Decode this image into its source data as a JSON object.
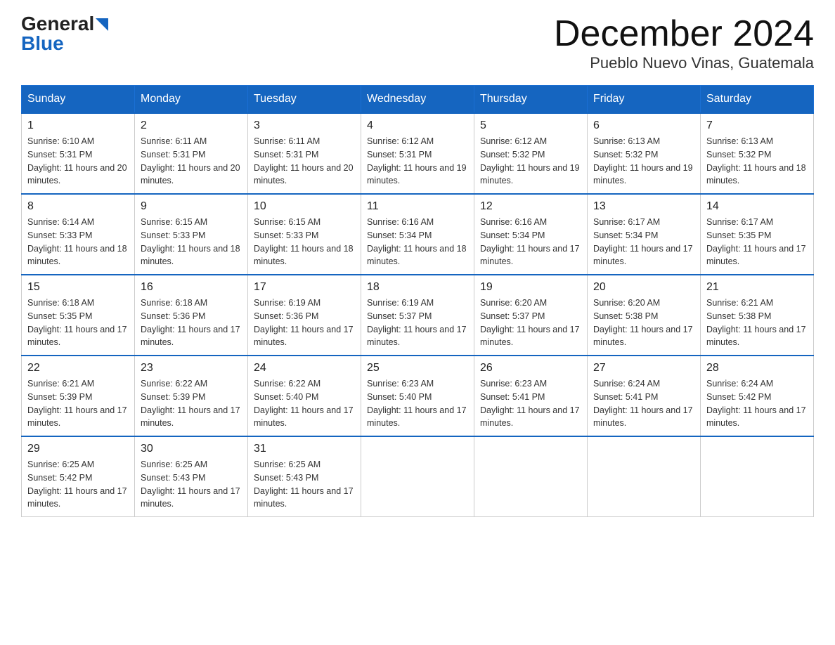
{
  "logo": {
    "general": "General",
    "blue": "Blue"
  },
  "title": "December 2024",
  "subtitle": "Pueblo Nuevo Vinas, Guatemala",
  "calendar": {
    "headers": [
      "Sunday",
      "Monday",
      "Tuesday",
      "Wednesday",
      "Thursday",
      "Friday",
      "Saturday"
    ],
    "weeks": [
      [
        {
          "day": "1",
          "sunrise": "6:10 AM",
          "sunset": "5:31 PM",
          "daylight": "11 hours and 20 minutes."
        },
        {
          "day": "2",
          "sunrise": "6:11 AM",
          "sunset": "5:31 PM",
          "daylight": "11 hours and 20 minutes."
        },
        {
          "day": "3",
          "sunrise": "6:11 AM",
          "sunset": "5:31 PM",
          "daylight": "11 hours and 20 minutes."
        },
        {
          "day": "4",
          "sunrise": "6:12 AM",
          "sunset": "5:31 PM",
          "daylight": "11 hours and 19 minutes."
        },
        {
          "day": "5",
          "sunrise": "6:12 AM",
          "sunset": "5:32 PM",
          "daylight": "11 hours and 19 minutes."
        },
        {
          "day": "6",
          "sunrise": "6:13 AM",
          "sunset": "5:32 PM",
          "daylight": "11 hours and 19 minutes."
        },
        {
          "day": "7",
          "sunrise": "6:13 AM",
          "sunset": "5:32 PM",
          "daylight": "11 hours and 18 minutes."
        }
      ],
      [
        {
          "day": "8",
          "sunrise": "6:14 AM",
          "sunset": "5:33 PM",
          "daylight": "11 hours and 18 minutes."
        },
        {
          "day": "9",
          "sunrise": "6:15 AM",
          "sunset": "5:33 PM",
          "daylight": "11 hours and 18 minutes."
        },
        {
          "day": "10",
          "sunrise": "6:15 AM",
          "sunset": "5:33 PM",
          "daylight": "11 hours and 18 minutes."
        },
        {
          "day": "11",
          "sunrise": "6:16 AM",
          "sunset": "5:34 PM",
          "daylight": "11 hours and 18 minutes."
        },
        {
          "day": "12",
          "sunrise": "6:16 AM",
          "sunset": "5:34 PM",
          "daylight": "11 hours and 17 minutes."
        },
        {
          "day": "13",
          "sunrise": "6:17 AM",
          "sunset": "5:34 PM",
          "daylight": "11 hours and 17 minutes."
        },
        {
          "day": "14",
          "sunrise": "6:17 AM",
          "sunset": "5:35 PM",
          "daylight": "11 hours and 17 minutes."
        }
      ],
      [
        {
          "day": "15",
          "sunrise": "6:18 AM",
          "sunset": "5:35 PM",
          "daylight": "11 hours and 17 minutes."
        },
        {
          "day": "16",
          "sunrise": "6:18 AM",
          "sunset": "5:36 PM",
          "daylight": "11 hours and 17 minutes."
        },
        {
          "day": "17",
          "sunrise": "6:19 AM",
          "sunset": "5:36 PM",
          "daylight": "11 hours and 17 minutes."
        },
        {
          "day": "18",
          "sunrise": "6:19 AM",
          "sunset": "5:37 PM",
          "daylight": "11 hours and 17 minutes."
        },
        {
          "day": "19",
          "sunrise": "6:20 AM",
          "sunset": "5:37 PM",
          "daylight": "11 hours and 17 minutes."
        },
        {
          "day": "20",
          "sunrise": "6:20 AM",
          "sunset": "5:38 PM",
          "daylight": "11 hours and 17 minutes."
        },
        {
          "day": "21",
          "sunrise": "6:21 AM",
          "sunset": "5:38 PM",
          "daylight": "11 hours and 17 minutes."
        }
      ],
      [
        {
          "day": "22",
          "sunrise": "6:21 AM",
          "sunset": "5:39 PM",
          "daylight": "11 hours and 17 minutes."
        },
        {
          "day": "23",
          "sunrise": "6:22 AM",
          "sunset": "5:39 PM",
          "daylight": "11 hours and 17 minutes."
        },
        {
          "day": "24",
          "sunrise": "6:22 AM",
          "sunset": "5:40 PM",
          "daylight": "11 hours and 17 minutes."
        },
        {
          "day": "25",
          "sunrise": "6:23 AM",
          "sunset": "5:40 PM",
          "daylight": "11 hours and 17 minutes."
        },
        {
          "day": "26",
          "sunrise": "6:23 AM",
          "sunset": "5:41 PM",
          "daylight": "11 hours and 17 minutes."
        },
        {
          "day": "27",
          "sunrise": "6:24 AM",
          "sunset": "5:41 PM",
          "daylight": "11 hours and 17 minutes."
        },
        {
          "day": "28",
          "sunrise": "6:24 AM",
          "sunset": "5:42 PM",
          "daylight": "11 hours and 17 minutes."
        }
      ],
      [
        {
          "day": "29",
          "sunrise": "6:25 AM",
          "sunset": "5:42 PM",
          "daylight": "11 hours and 17 minutes."
        },
        {
          "day": "30",
          "sunrise": "6:25 AM",
          "sunset": "5:43 PM",
          "daylight": "11 hours and 17 minutes."
        },
        {
          "day": "31",
          "sunrise": "6:25 AM",
          "sunset": "5:43 PM",
          "daylight": "11 hours and 17 minutes."
        },
        null,
        null,
        null,
        null
      ]
    ]
  }
}
